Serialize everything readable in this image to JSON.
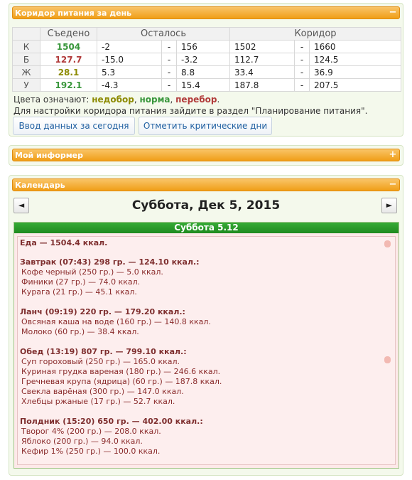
{
  "corridor": {
    "title": "Коридор питания за день",
    "collapse_icon": "−",
    "headers": {
      "eaten": "Съедено",
      "remaining": "Осталось",
      "corridor": "Коридор"
    },
    "rows": [
      {
        "label": "К",
        "eaten": "1504",
        "eaten_color": "green",
        "rem_min": "-2",
        "rem_sep": "-",
        "rem_max": "156",
        "cor_min": "1502",
        "cor_sep": "-",
        "cor_max": "1660"
      },
      {
        "label": "Б",
        "eaten": "127.7",
        "eaten_color": "red",
        "rem_min": "-15.0",
        "rem_sep": "-",
        "rem_max": "-3.2",
        "cor_min": "112.7",
        "cor_sep": "-",
        "cor_max": "124.5"
      },
      {
        "label": "Ж",
        "eaten": "28.1",
        "eaten_color": "olive",
        "rem_min": "5.3",
        "rem_sep": "-",
        "rem_max": "8.8",
        "cor_min": "33.4",
        "cor_sep": "-",
        "cor_max": "36.9"
      },
      {
        "label": "У",
        "eaten": "192.1",
        "eaten_color": "green",
        "rem_min": "-4.3",
        "rem_sep": "-",
        "rem_max": "15.4",
        "cor_min": "187.8",
        "cor_sep": "-",
        "cor_max": "207.5"
      }
    ],
    "legend_prefix": "Цвета означают: ",
    "legend_under": "недобор",
    "legend_comma1": ", ",
    "legend_norm": "норма",
    "legend_comma2": ", ",
    "legend_over": "перебор",
    "legend_end": ".",
    "info": "Для настройки коридора питания зайдите в раздел \"Планирование питания\".",
    "btn_input": "Ввод данных за сегодня",
    "btn_critical": "Отметить критические дни",
    "colors": {
      "green": "#37963a",
      "red": "#b13a3a",
      "olive": "#8c8a00"
    }
  },
  "informer": {
    "title": "Мой информер",
    "expand_icon": "+"
  },
  "calendar": {
    "title": "Календарь",
    "collapse_icon": "−",
    "prev": "◄",
    "next": "►",
    "date": "Суббота, Дек 5, 2015",
    "day_label": "Суббота 5.12",
    "lines": [
      {
        "text": "Еда — 1504.4 ккал.",
        "kind": "b"
      },
      {
        "text": "Завтрак (07:43) 298 гр. — 124.10 ккал.:",
        "kind": "b"
      },
      {
        "text": "Кофе черный (250 гр.) — 5.0 ккал.",
        "kind": "sub"
      },
      {
        "text": "Финики (27 гр.) — 74.0 ккал.",
        "kind": "sub"
      },
      {
        "text": "Курага (21 гр.) — 45.1 ккал.",
        "kind": "sub"
      },
      {
        "text": "Ланч (09:19) 220 гр. — 179.20 ккал.:",
        "kind": "b"
      },
      {
        "text": "Овсяная каша на воде (160 гр.) — 140.8 ккал.",
        "kind": "sub"
      },
      {
        "text": "Молоко (60 гр.) — 38.4 ккал.",
        "kind": "sub"
      },
      {
        "text": "Обед (13:19) 807 гр. — 799.10 ккал.:",
        "kind": "b"
      },
      {
        "text": "Суп гороховый (250 гр.) — 165.0 ккал.",
        "kind": "sub"
      },
      {
        "text": "Куриная грудка вареная (180 гр.) — 246.6 ккал.",
        "kind": "sub"
      },
      {
        "text": "Гречневая крупа (ядрица) (60 гр.) — 187.8 ккал.",
        "kind": "sub"
      },
      {
        "text": "Свекла варёная (300 гр.) — 147.0 ккал.",
        "kind": "sub"
      },
      {
        "text": "Хлебцы ржаные (17 гр.) — 52.7 ккал.",
        "kind": "sub"
      },
      {
        "text": "Полдник (15:20) 650 гр. — 402.00 ккал.:",
        "kind": "b"
      },
      {
        "text": "Творог 4% (200 гр.) — 208.0 ккал.",
        "kind": "sub"
      },
      {
        "text": "Яблоко (200 гр.) — 94.0 ккал.",
        "kind": "sub"
      },
      {
        "text": "Кефир 1% (250 гр.) — 100.0 ккал.",
        "kind": "sub"
      }
    ]
  }
}
